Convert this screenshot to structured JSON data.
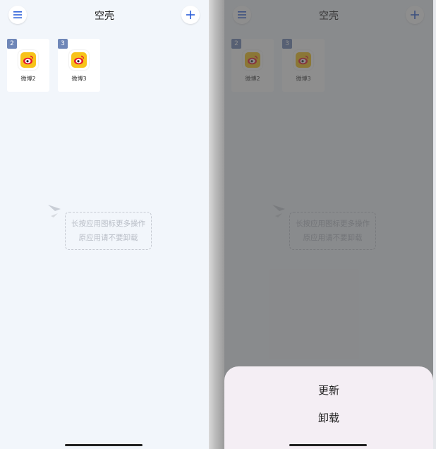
{
  "header": {
    "title": "空壳",
    "menu_icon": "hamburger-menu-icon",
    "add_icon": "plus-icon"
  },
  "apps": [
    {
      "badge": "2",
      "label": "微博2",
      "icon": "weibo-icon"
    },
    {
      "badge": "3",
      "label": "微博3",
      "icon": "weibo-icon"
    }
  ],
  "hint": {
    "line1": "长按应用图标更多操作",
    "line2": "原应用请不要卸载"
  },
  "action_sheet": {
    "update": "更新",
    "uninstall": "卸载"
  },
  "colors": {
    "accent": "#2b5fd9",
    "badge": "#6f87b8",
    "weibo_yellow": "#f7c31a",
    "weibo_red": "#e6162d"
  }
}
